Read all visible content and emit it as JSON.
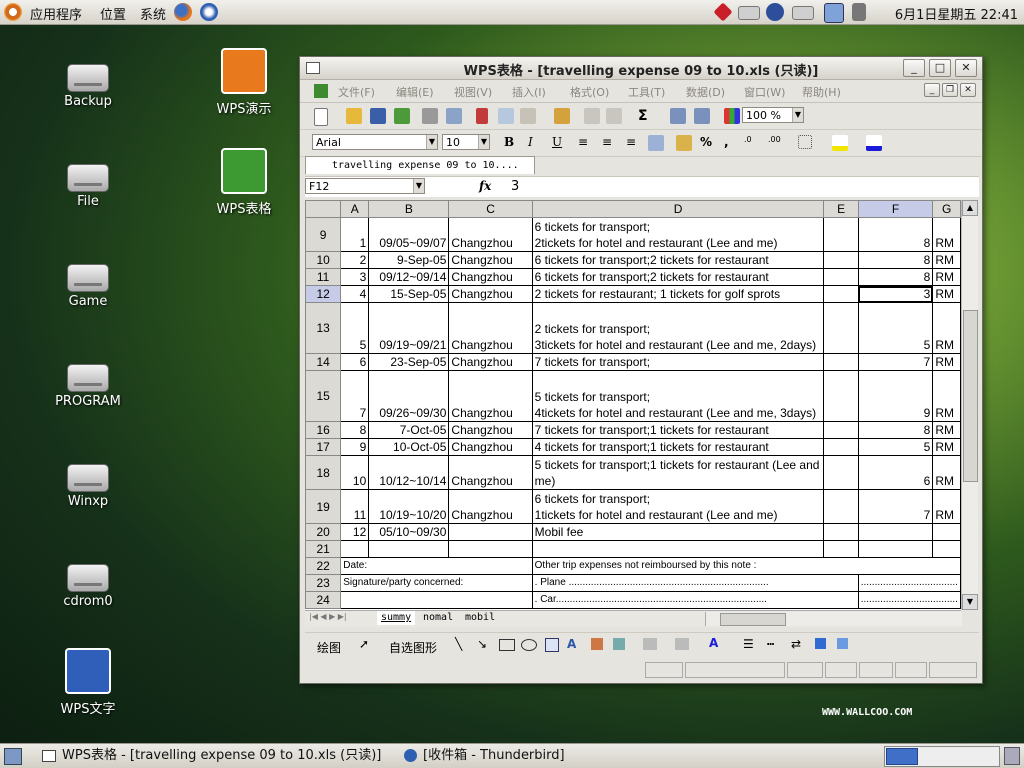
{
  "top_panel": {
    "apps_menu": "应用程序",
    "places_menu": "位置",
    "system_menu": "系统",
    "clock": "6月1日星期五 22:41"
  },
  "desktop_icons": {
    "backup": "Backup",
    "file": "File",
    "game": "Game",
    "program": "PROGRAM",
    "winxp": "Winxp",
    "cdrom": "cdrom0",
    "wps_present": "WPS演示",
    "wps_sheet": "WPS表格",
    "wps_writer": "WPS文字"
  },
  "watermark": "WWW.WALLCOO.COM",
  "window": {
    "title": "WPS表格 - [travelling expense 09 to 10.xls (只读)]",
    "menus": [
      "文件(F)",
      "编辑(E)",
      "视图(V)",
      "插入(I)",
      "格式(O)",
      "工具(T)",
      "数据(D)",
      "窗口(W)",
      "帮助(H)"
    ],
    "zoom": "100 %",
    "font_name": "Arial",
    "font_size": "10",
    "doc_tab": "travelling expense 09 to 10....",
    "name_box": "F12",
    "fx": "fx",
    "formula_value": "3",
    "sheet_tabs": [
      "summy",
      "nomal",
      "mobil"
    ],
    "draw_label": "绘图",
    "autoshape_label": "自选图形"
  },
  "sheet": {
    "columns": [
      "A",
      "B",
      "C",
      "D",
      "E",
      "F",
      "G"
    ],
    "rows": [
      {
        "row": "9",
        "a": "1",
        "b": "09/05~09/07",
        "c": "Changzhou",
        "d": "6 tickets for transport;\n2tickets for hotel and restaurant (Lee and me)",
        "e": "",
        "f": "8",
        "g": "RM"
      },
      {
        "row": "10",
        "a": "2",
        "b": "9-Sep-05",
        "c": "Changzhou",
        "d": "6 tickets for transport;2 tickets for restaurant",
        "e": "",
        "f": "8",
        "g": "RM"
      },
      {
        "row": "11",
        "a": "3",
        "b": "09/12~09/14",
        "c": "Changzhou",
        "d": "6 tickets for transport;2 tickets for restaurant",
        "e": "",
        "f": "8",
        "g": "RM"
      },
      {
        "row": "12",
        "a": "4",
        "b": "15-Sep-05",
        "c": "Changzhou",
        "d": "2 tickets for restaurant; 1 tickets for golf sprots",
        "e": "",
        "f": "3",
        "g": "RM"
      },
      {
        "row": "13",
        "a": "5",
        "b": "09/19~09/21",
        "c": "Changzhou",
        "d": "2 tickets for transport;\n3tickets for hotel and restaurant (Lee and me, 2days)",
        "e": "",
        "f": "5",
        "g": "RM"
      },
      {
        "row": "14",
        "a": "6",
        "b": "23-Sep-05",
        "c": "Changzhou",
        "d": "7 tickets for transport;",
        "e": "",
        "f": "7",
        "g": "RM"
      },
      {
        "row": "15",
        "a": "7",
        "b": "09/26~09/30",
        "c": "Changzhou",
        "d": "5 tickets for transport;\n4tickets for hotel and restaurant (Lee and me, 3days)",
        "e": "",
        "f": "9",
        "g": "RM"
      },
      {
        "row": "16",
        "a": "8",
        "b": "7-Oct-05",
        "c": "Changzhou",
        "d": "7 tickets for transport;1 tickets for restaurant",
        "e": "",
        "f": "8",
        "g": "RM"
      },
      {
        "row": "17",
        "a": "9",
        "b": "10-Oct-05",
        "c": "Changzhou",
        "d": "4 tickets for transport;1 tickets for restaurant",
        "e": "",
        "f": "5",
        "g": "RM"
      },
      {
        "row": "18",
        "a": "10",
        "b": "10/12~10/14",
        "c": "Changzhou",
        "d": "5 tickets for transport;1 tickets for restaurant (Lee and me)",
        "e": "",
        "f": "6",
        "g": "RM"
      },
      {
        "row": "19",
        "a": "11",
        "b": "10/19~10/20",
        "c": "Changzhou",
        "d": "6 tickets for transport;\n1tickets for hotel and restaurant (Lee and me)",
        "e": "",
        "f": "7",
        "g": "RM"
      },
      {
        "row": "20",
        "a": "12",
        "b": "05/10~09/30",
        "c": "",
        "d": "Mobil fee",
        "e": "",
        "f": "",
        "g": ""
      },
      {
        "row": "21",
        "a": "",
        "b": "",
        "c": "",
        "d": "",
        "e": "",
        "f": "",
        "g": ""
      }
    ],
    "row22_num": "22",
    "row22_date": "Date:",
    "row22_note": "Other trip expenses not reimboursed by this note :",
    "row23_num": "23",
    "row23_sig": "Signature/party concerned:",
    "row23_plane": ". Plane ........................................................................",
    "row23_dots": "...................................",
    "row24_num": "24",
    "row24_car": ". Car............................................................................",
    "row24_dots": "..................................."
  },
  "taskbar": {
    "task1": "WPS表格 - [travelling expense 09 to 10.xls (只读)]",
    "task2": "[收件箱 - Thunderbird]"
  }
}
